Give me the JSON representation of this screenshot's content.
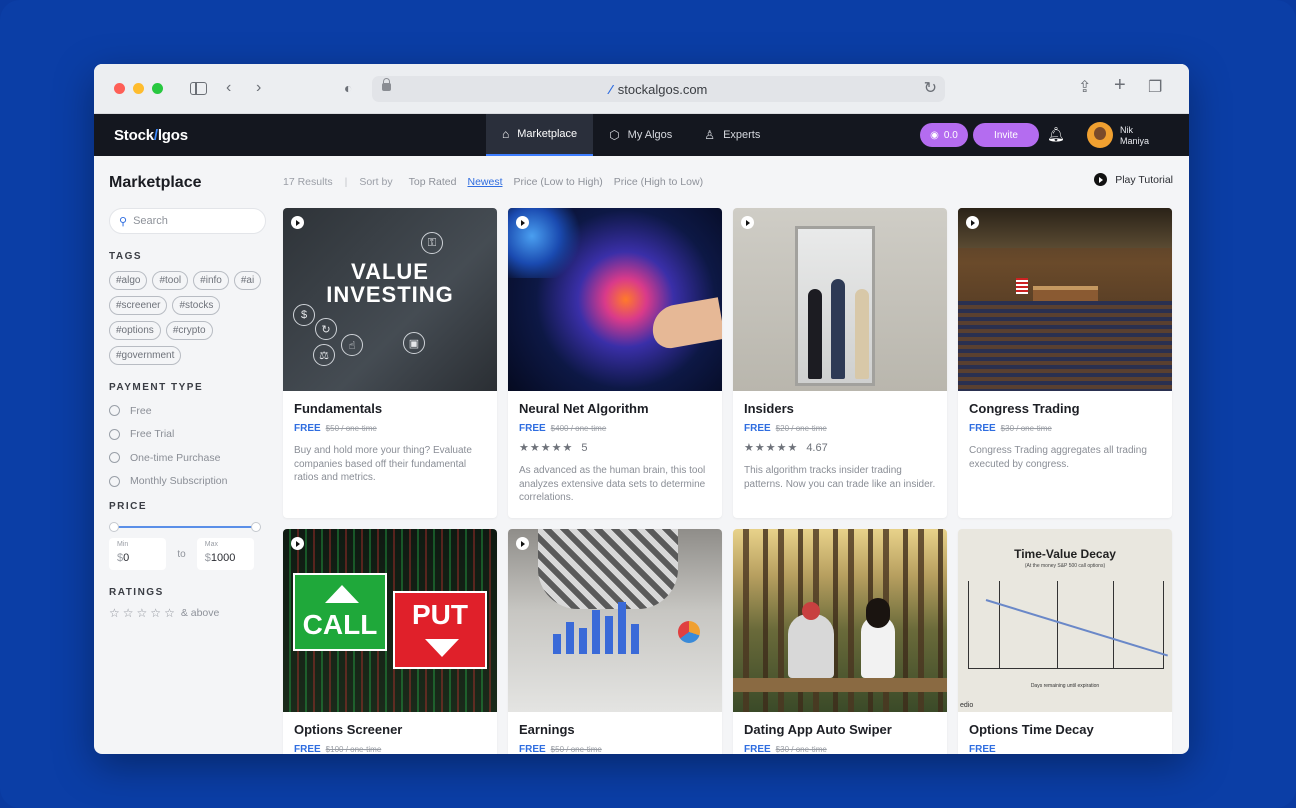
{
  "browser": {
    "url": "stockalgos.com"
  },
  "app": {
    "logo_prefix": "Stock",
    "logo_slash": "/",
    "logo_suffix": "lgos",
    "nav": [
      {
        "label": "Marketplace"
      },
      {
        "label": "My Algos"
      },
      {
        "label": "Experts"
      }
    ],
    "credits": "0.0",
    "invite": "Invite",
    "user_first": "Nik",
    "user_last": "Maniya"
  },
  "sidebar": {
    "title": "Marketplace",
    "search_placeholder": "Search",
    "tags_label": "TAGS",
    "tags": [
      "#algo",
      "#tool",
      "#info",
      "#ai",
      "#screener",
      "#stocks",
      "#options",
      "#crypto",
      "#government"
    ],
    "payment_label": "PAYMENT TYPE",
    "payment_types": [
      "Free",
      "Free Trial",
      "One-time Purchase",
      "Monthly Subscription"
    ],
    "price_label": "PRICE",
    "min_label": "Min",
    "max_label": "Max",
    "currency": "$",
    "min_value": "0",
    "max_value": "1000",
    "to_label": "to",
    "ratings_label": "RATINGS",
    "ratings_suffix": "& above"
  },
  "sortbar": {
    "results": "17 Results",
    "sort_by": "Sort by",
    "options": [
      "Top Rated",
      "Newest",
      "Price (Low to High)",
      "Price (High to Low)"
    ],
    "active": "Newest",
    "play_tutorial": "Play Tutorial"
  },
  "cards": [
    {
      "title": "Fundamentals",
      "price": "FREE",
      "original": "$50 / one-time",
      "rating": "",
      "desc": "Buy and hold more your thing? Evaluate companies based off their fundamental ratios and metrics.",
      "img_text_1": "VALUE",
      "img_text_2": "INVESTING"
    },
    {
      "title": "Neural Net Algorithm",
      "price": "FREE",
      "original": "$400 / one-time",
      "rating": "5",
      "stars": "★★★★★",
      "desc": "As advanced as the human brain, this tool analyzes extensive data sets to determine correlations."
    },
    {
      "title": "Insiders",
      "price": "FREE",
      "original": "$20 / one-time",
      "rating": "4.67",
      "stars": "★★★★★",
      "desc": "This algorithm tracks insider trading patterns. Now you can trade like an insider."
    },
    {
      "title": "Congress Trading",
      "price": "FREE",
      "original": "$30 / one-time",
      "rating": "",
      "desc": "Congress Trading aggregates all trading executed by congress."
    },
    {
      "title": "Options Screener",
      "price": "FREE",
      "original": "$100 / one-time",
      "img_call": "CALL",
      "img_put": "PUT"
    },
    {
      "title": "Earnings",
      "price": "FREE",
      "original": "$50 / one-time"
    },
    {
      "title": "Dating App Auto Swiper",
      "price": "FREE",
      "original": "$30 / one-time"
    },
    {
      "title": "Options Time Decay",
      "price": "FREE",
      "original": "",
      "img_title": "Time-Value Decay",
      "img_sub": "(At the money S&P 500 call options)",
      "img_xlabel": "Days remaining until expiration",
      "img_brand": "edio"
    }
  ],
  "colors": {
    "accent": "#2f6de0",
    "pill": "#b46cf0",
    "nav_bg": "#14171f",
    "page_bg": "#0b3ea6"
  }
}
